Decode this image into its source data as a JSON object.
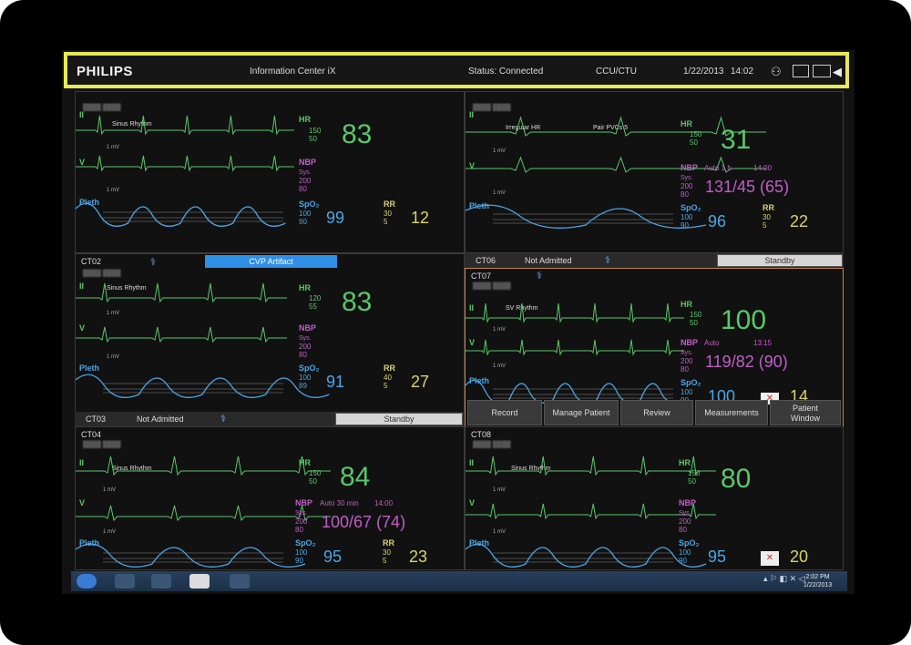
{
  "topbar": {
    "brand": "PHILIPS",
    "app_title": "Information Center iX",
    "status": "Status: Connected",
    "unit": "CCU/CTU",
    "date": "1/22/2013",
    "time": "14:02"
  },
  "panels": {
    "p1": {
      "rhythm": "Sinus Rhythm",
      "hr": "83",
      "hr_hi": "150",
      "hr_lo": "50",
      "spo2": "99",
      "spo2_hi": "100",
      "spo2_lo": "90",
      "rr": "12",
      "rr_hi": "30",
      "rr_lo": "5",
      "sys_hi": "200",
      "sys_lo": "80"
    },
    "p2": {
      "rhythm": "Irregular HR",
      "rhythm2": "Pair PVCs 5",
      "hr": "31",
      "hr_hi": "150",
      "hr_lo": "50",
      "nbp_auto": "Auto 1 h",
      "nbp_time": "14:00",
      "nbp": "131/45 (65)",
      "spo2": "96",
      "spo2_hi": "100",
      "spo2_lo": "90",
      "rr": "22",
      "rr_hi": "30",
      "rr_lo": "5",
      "sys_hi": "200",
      "sys_lo": "80"
    },
    "p3": {
      "bed": "CT02",
      "alert": "CVP Artifact",
      "rhythm": "Sinus Rhythm",
      "hr": "83",
      "hr_hi": "120",
      "hr_lo": "55",
      "spo2": "91",
      "spo2_hi": "100",
      "spo2_lo": "89",
      "rr": "27",
      "rr_hi": "40",
      "rr_lo": "5",
      "sys_hi": "200",
      "sys_lo": "80"
    },
    "p4": {
      "bed": "CT06",
      "status": "Not Admitted",
      "standby": "Standby"
    },
    "p5": {
      "bed": "CT07",
      "rhythm": "SV Rhythm",
      "hr": "100",
      "hr_hi": "150",
      "hr_lo": "50",
      "nbp_auto": "Auto",
      "nbp_time": "13:15",
      "nbp": "119/82 (90)",
      "spo2": "100",
      "spo2_hi": "100",
      "spo2_lo": "90",
      "rr": "14",
      "sys_hi": "200",
      "sys_lo": "80"
    },
    "p6": {
      "bed": "CT03",
      "status": "Not Admitted",
      "standby": "Standby"
    },
    "p7": {
      "bed": "CT04",
      "rhythm": "Sinus Rhythm",
      "hr": "84",
      "hr_hi": "150",
      "hr_lo": "50",
      "nbp_auto": "Auto 30 min",
      "nbp_time": "14:00",
      "nbp": "100/67 (74)",
      "spo2": "95",
      "spo2_hi": "100",
      "spo2_lo": "90",
      "rr": "23",
      "rr_hi": "30",
      "rr_lo": "5",
      "sys_hi": "200",
      "sys_lo": "80"
    },
    "p8": {
      "bed": "CT08",
      "rhythm": "Sinus Rhythm",
      "hr": "80",
      "hr_hi": "150",
      "hr_lo": "50",
      "spo2": "95",
      "spo2_hi": "100",
      "spo2_lo": "90",
      "rr": "20",
      "sys_hi": "200",
      "sys_lo": "80"
    }
  },
  "labels": {
    "hr": "HR",
    "nbp": "NBP",
    "sys": "Sys.",
    "spo2": "SpO₂",
    "rr": "RR",
    "lead2": "II",
    "lead_v": "V",
    "pleth": "Pleth",
    "mv": "1 mV"
  },
  "action_buttons": [
    "Record",
    "Manage Patient",
    "Review",
    "Measurements",
    "Patient Window"
  ],
  "taskbar": {
    "time": "2:02 PM",
    "date": "1/22/2013"
  },
  "colors": {
    "ecg": "#59c86a",
    "nbp": "#c25ec8",
    "spo2": "#4aa6e6",
    "rr": "#d9d36a",
    "highlight": "#e7ea55",
    "alert_button": "#2f8ee5"
  }
}
